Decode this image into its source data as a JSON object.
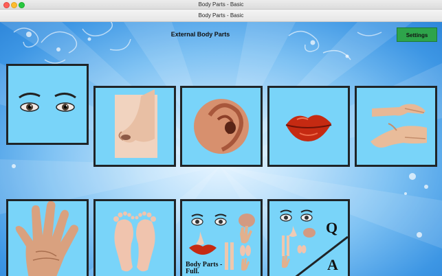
{
  "window": {
    "title": "Body Parts - Basic",
    "toolbar_title": "Body Parts - Basic"
  },
  "header": {
    "heading": "External Body Parts",
    "settings_label": "Settings"
  },
  "tiles": [
    {
      "name": "eyes"
    },
    {
      "name": "nose"
    },
    {
      "name": "ear"
    },
    {
      "name": "lips"
    },
    {
      "name": "hands"
    },
    {
      "name": "palm"
    },
    {
      "name": "feet"
    },
    {
      "name": "body-parts-full",
      "label_line1": "Body Parts -",
      "label_line2": "Full."
    },
    {
      "name": "quiz",
      "q": "Q",
      "a": "A"
    }
  ],
  "colors": {
    "tile_bg": "#79d4f9",
    "tile_border": "#1f2427",
    "settings_bg": "#2ea44b",
    "background": "#4aa6ec"
  }
}
